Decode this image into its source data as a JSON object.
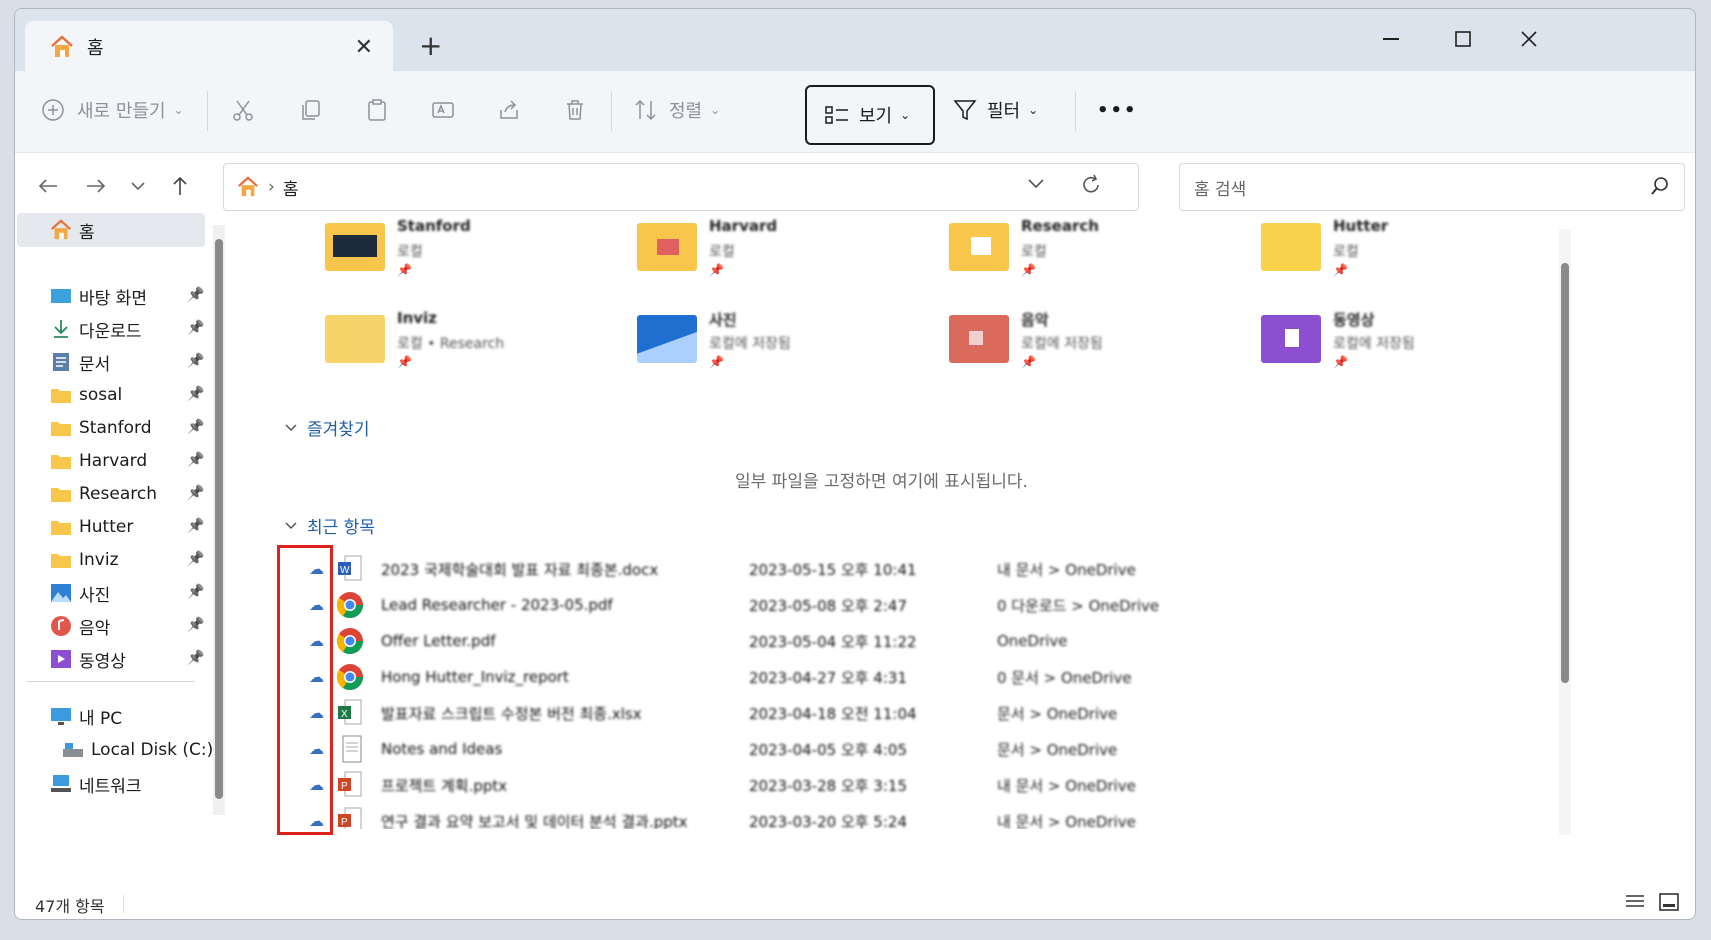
{
  "tab": {
    "title": "홈",
    "close_icon": "close-icon",
    "new_tab": "+"
  },
  "commands": {
    "new": "새로 만들기",
    "sort": "정렬",
    "view": "보기",
    "filter": "필터",
    "more": "•••"
  },
  "address": {
    "path_home": "홈",
    "search_placeholder": "홈 검색"
  },
  "sidebar": {
    "home": "홈",
    "items": [
      {
        "label": "바탕 화면",
        "icon": "desktop-icon"
      },
      {
        "label": "다운로드",
        "icon": "download-icon"
      },
      {
        "label": "문서",
        "icon": "document-icon"
      },
      {
        "label": "sosal",
        "icon": "folder-icon"
      },
      {
        "label": "Stanford",
        "icon": "folder-icon"
      },
      {
        "label": "Harvard",
        "icon": "folder-icon"
      },
      {
        "label": "Research",
        "icon": "folder-icon"
      },
      {
        "label": "Hutter",
        "icon": "folder-icon"
      },
      {
        "label": "Inviz",
        "icon": "folder-icon"
      },
      {
        "label": "사진",
        "icon": "pictures-icon"
      },
      {
        "label": "음악",
        "icon": "music-icon"
      },
      {
        "label": "동영상",
        "icon": "videos-icon"
      }
    ],
    "pc": "내 PC",
    "disk": "Local Disk (C:)",
    "network": "네트워크"
  },
  "quick_access": [
    {
      "name": "Stanford",
      "sub": "로컬"
    },
    {
      "name": "Harvard",
      "sub": "로컬"
    },
    {
      "name": "Research",
      "sub": "로컬"
    },
    {
      "name": "Hutter",
      "sub": "로컬"
    },
    {
      "name": "Inviz",
      "sub": "로컬 • Research"
    },
    {
      "name": "사진",
      "sub": "로컬에 저장됨"
    },
    {
      "name": "음악",
      "sub": "로컬에 저장됨"
    },
    {
      "name": "동영상",
      "sub": "로컬에 저장됨"
    }
  ],
  "favorites": {
    "title": "즐겨찾기",
    "empty": "일부 파일을 고정하면 여기에 표시됩니다."
  },
  "recent": {
    "title": "최근 항목",
    "rows": [
      {
        "name": "2023 국제학술대회 발표 자료 최종본.docx",
        "date": "2023-05-15 오후 10:41",
        "loc": "내 문서 > OneDrive",
        "type": "word"
      },
      {
        "name": "Lead Researcher - 2023-05.pdf",
        "date": "2023-05-08 오후 2:47",
        "loc": "0 다운로드 > OneDrive",
        "type": "pdf"
      },
      {
        "name": "Offer Letter.pdf",
        "date": "2023-05-04 오후 11:22",
        "loc": "OneDrive",
        "type": "pdf"
      },
      {
        "name": "Hong Hutter_Inviz_report",
        "date": "2023-04-27 오후 4:31",
        "loc": "0 문서 > OneDrive",
        "type": "pdf"
      },
      {
        "name": "발표자료 스크립트 수정본 버전 최종.xlsx",
        "date": "2023-04-18 오전 11:04",
        "loc": "문서 > OneDrive",
        "type": "excel"
      },
      {
        "name": "Notes and Ideas",
        "date": "2023-04-05 오후 4:05",
        "loc": "문서 > OneDrive",
        "type": "doc"
      },
      {
        "name": "프로젝트 계획.pptx",
        "date": "2023-03-28 오후 3:15",
        "loc": "내 문서 > OneDrive",
        "type": "ppt"
      },
      {
        "name": "연구 결과 요약 보고서 및 데이터 분석 결과.pptx",
        "date": "2023-03-20 오후 5:24",
        "loc": "내 문서 > OneDrive",
        "type": "ppt"
      }
    ]
  },
  "status": {
    "count": "47개 항목"
  }
}
